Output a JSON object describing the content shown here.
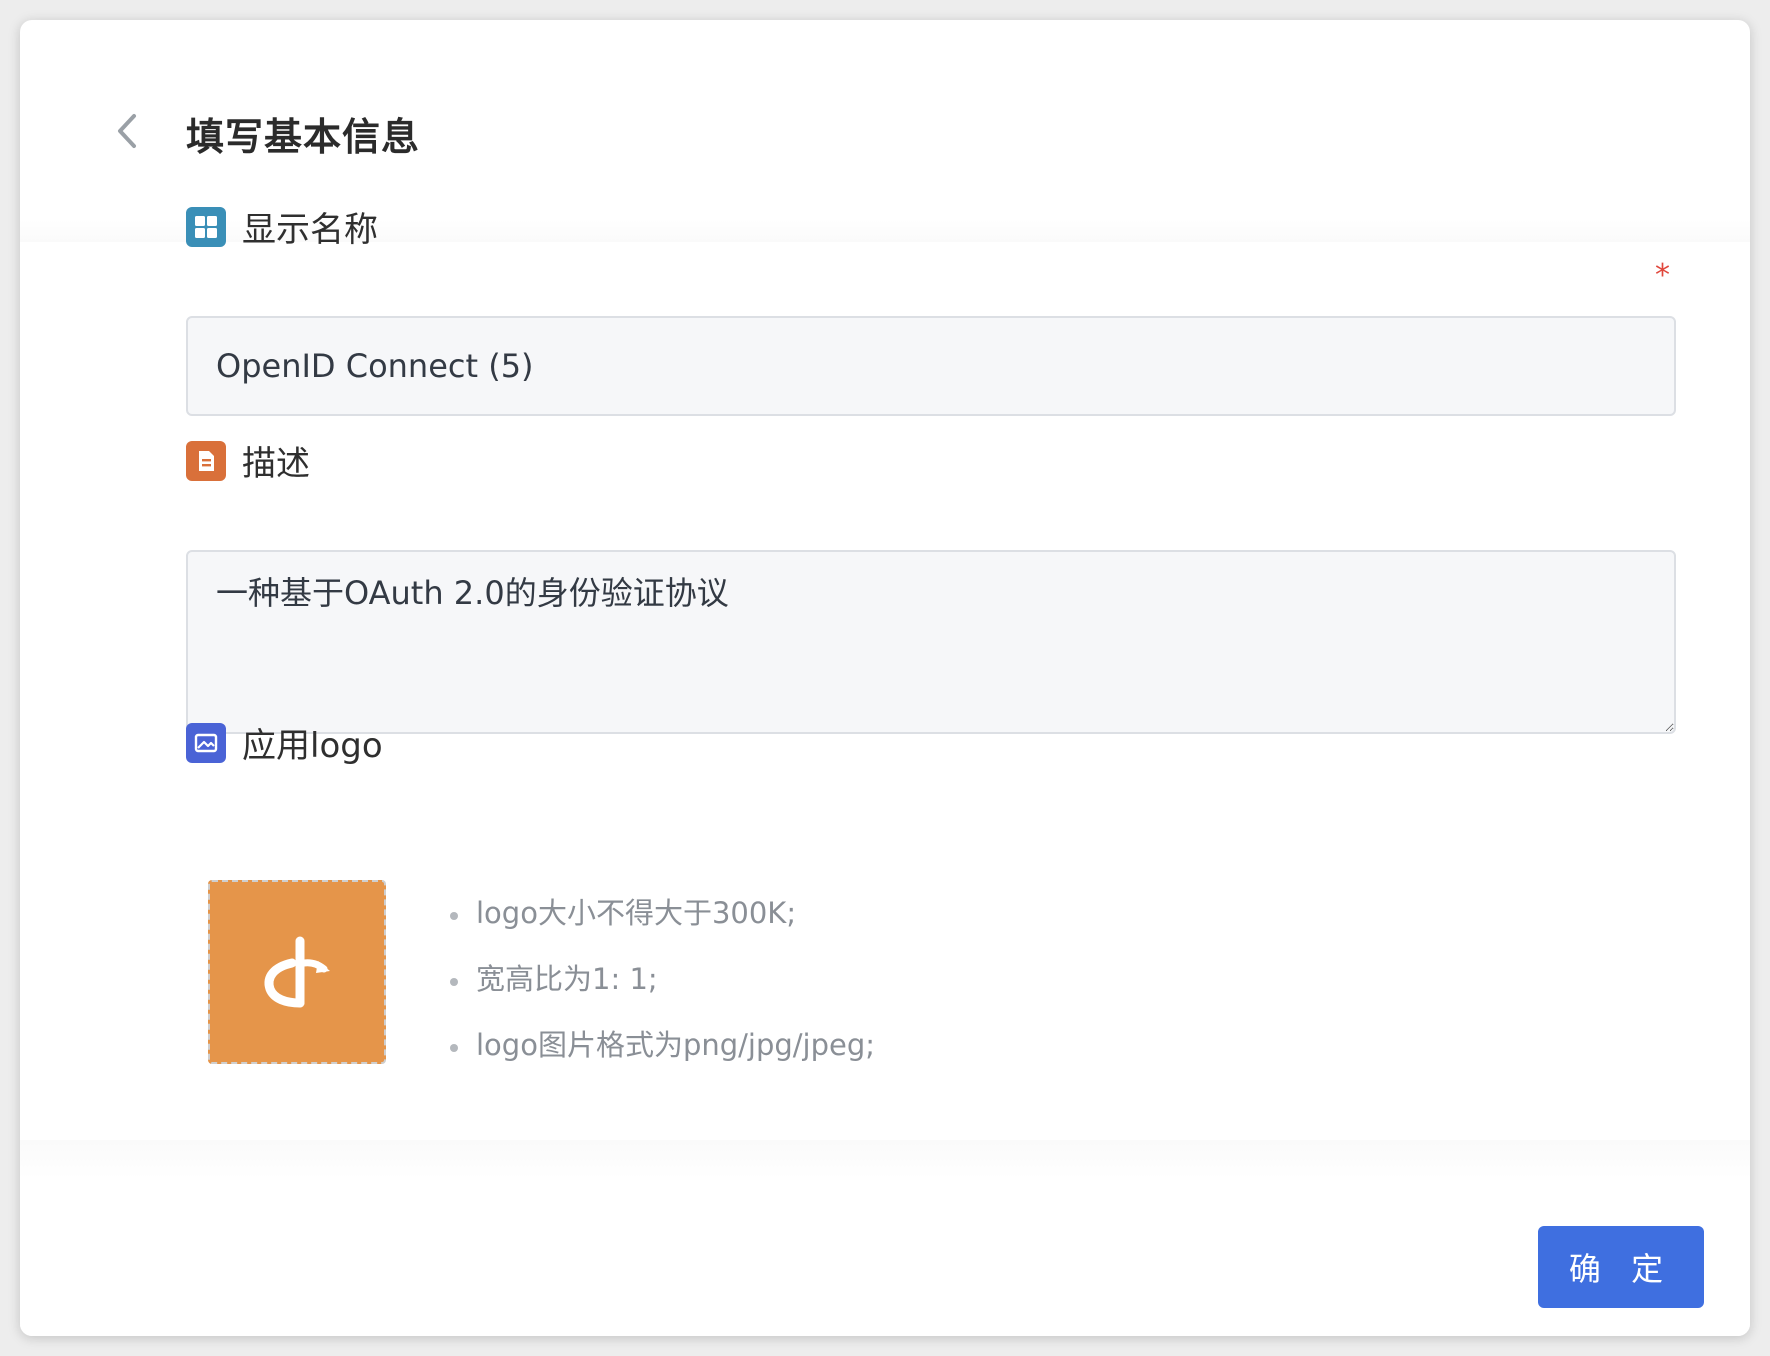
{
  "header": {
    "title": "填写基本信息"
  },
  "form": {
    "display_name": {
      "label": "显示名称",
      "required_mark": "*",
      "value": "OpenID Connect (5)"
    },
    "description": {
      "label": "描述",
      "value": "一种基于OAuth 2.0的身份验证协议"
    },
    "logo": {
      "label": "应用logo",
      "hints": [
        "logo大小不得大于300K;",
        "宽高比为1: 1;",
        "logo图片格式为png/jpg/jpeg;"
      ]
    }
  },
  "footer": {
    "confirm_label": "确 定"
  },
  "colors": {
    "primary": "#3f6fe0",
    "required": "#e0473c",
    "name_icon": "#3a8fb7",
    "desc_icon": "#d9703a",
    "logo_icon": "#4a63d6",
    "logo_bg": "#e5954a"
  },
  "icons": {
    "back": "chevron-left-icon",
    "name": "grid-icon",
    "description": "document-icon",
    "logo": "image-icon",
    "app_logo": "openid-icon"
  }
}
